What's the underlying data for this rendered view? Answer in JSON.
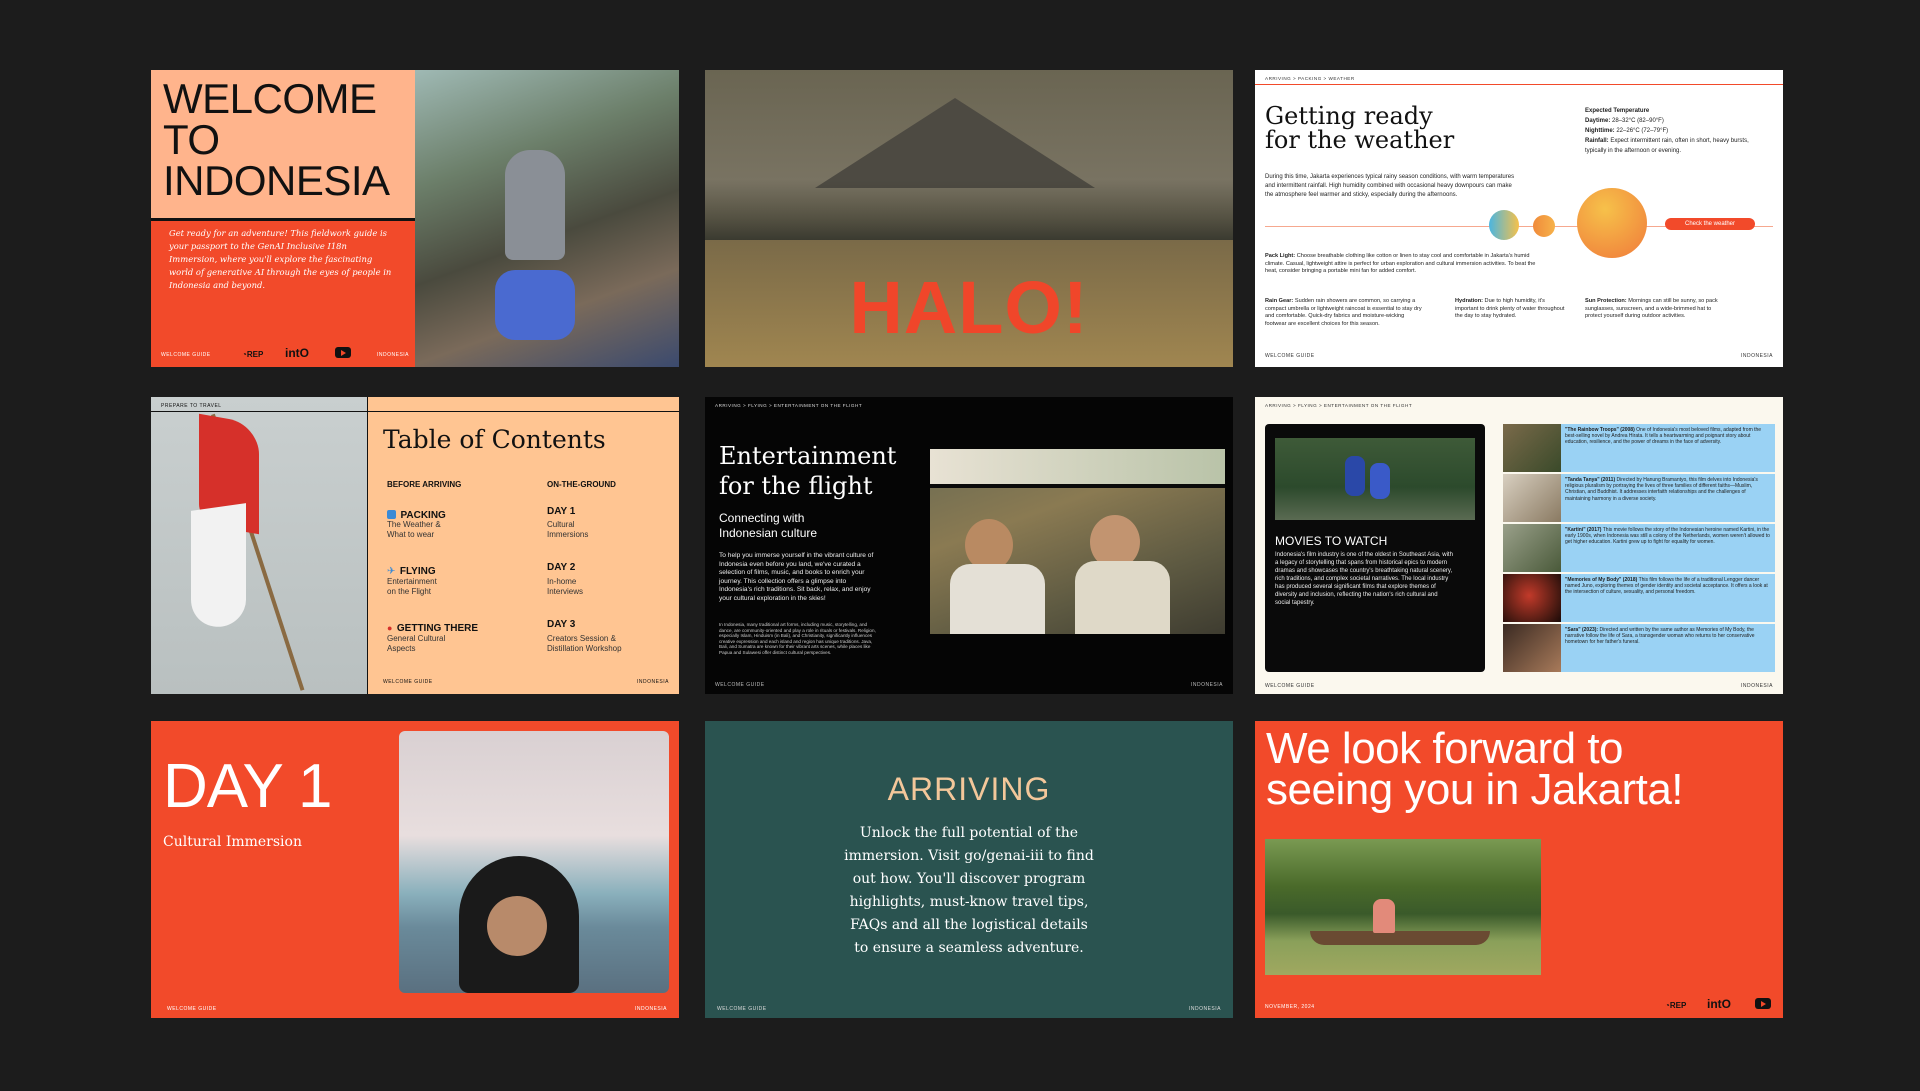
{
  "slide1": {
    "title_lines": [
      "WELCOME",
      "TO",
      "INDONESIA"
    ],
    "intro": "Get ready for an adventure! This fieldwork guide is your passport to the GenAI Inclusive I18n Immersion, where you'll explore the fascinating world of generative AI through the eyes of people in Indonesia and beyond.",
    "footer_left": "WELCOME GUIDE",
    "footer_right": "INDONESIA",
    "logo_rep": "REP",
    "logo_into": "intO"
  },
  "slide2": {
    "headline": "HALO!"
  },
  "slide3": {
    "breadcrumb": "ARRIVING > PACKING > WEATHER",
    "title_line1": "Getting ready",
    "title_line2": "for the weather",
    "temp_heading": "Expected Temperature",
    "daytime_label": "Daytime:",
    "daytime_value": "28–32°C (82–90°F)",
    "nighttime_label": "Nighttime:",
    "nighttime_value": "22–26°C (72–79°F)",
    "rainfall_label": "Rainfall:",
    "rainfall_value": "Expect intermittent rain, often in short, heavy bursts, typically in the afternoon or evening.",
    "intro": "During this time, Jakarta experiences typical rainy season conditions, with warm temperatures and intermittent rainfall. High humidity combined with occasional heavy downpours can make the atmosphere feel warmer and sticky, especially during the afternoons.",
    "check_button": "Check the weather",
    "pack_label": "Pack Light:",
    "pack_text": "Choose breathable clothing like cotton or linen to stay cool and comfortable in Jakarta's humid climate. Casual, lightweight attire is perfect for urban exploration and cultural immersion activities. To beat the heat, consider bringing a portable mini fan for added comfort.",
    "rain_label": "Rain Gear:",
    "rain_text": "Sudden rain showers are common, so carrying a compact umbrella or lightweight raincoat is essential to stay dry and comfortable. Quick-dry fabrics and moisture-wicking footwear are excellent choices for this season.",
    "hydration_label": "Hydration:",
    "hydration_text": "Due to high humidity, it's important to drink plenty of water throughout the day to stay hydrated.",
    "sun_label": "Sun Protection:",
    "sun_text": "Mornings can still be sunny, so pack sunglasses, sunscreen, and a wide-brimmed hat to protect yourself during outdoor activities.",
    "footer_left": "WELCOME GUIDE",
    "footer_right": "INDONESIA"
  },
  "slide4": {
    "label": "PREPARE TO TRAVEL",
    "title": "Table of Contents",
    "col1_heading": "BEFORE ARRIVING",
    "col2_heading": "ON-THE-GROUND",
    "packing": "PACKING",
    "packing_sub1": "The Weather &",
    "packing_sub2": "What to wear",
    "flying": "FLYING",
    "flying_sub1": "Entertainment",
    "flying_sub2": "on the Flight",
    "getting": "GETTING THERE",
    "getting_sub1": "General Cultural",
    "getting_sub2": "Aspects",
    "day1": "DAY 1",
    "day1_sub1": "Cultural",
    "day1_sub2": "Immersions",
    "day2": "DAY 2",
    "day2_sub1": "In-home",
    "day2_sub2": "Interviews",
    "day3": "DAY 3",
    "day3_sub1": "Creators Session &",
    "day3_sub2": "Distillation Workshop",
    "footer_left": "WELCOME GUIDE",
    "footer_right": "INDONESIA"
  },
  "slide5": {
    "breadcrumb": "ARRIVING > FLYING > ENTERTAINMENT ON THE FLIGHT",
    "title_line1": "Entertainment",
    "title_line2": "for the flight",
    "subtitle_line1": "Connecting with",
    "subtitle_line2": "Indonesian culture",
    "body": "To help you immerse yourself in the vibrant culture of Indonesia even before you land, we've curated a selection of films, music, and books to enrich your journey. This collection offers a glimpse into Indonesia's rich traditions. Sit back, relax, and enjoy your cultural exploration in the skies!",
    "small": "In Indonesia, many traditional art forms, including music, storytelling, and dance, are community-oriented and play a role in rituals or festivals. Religion, especially Islam, Hinduism (in Bali), and Christianity, significantly influences creative expression and each island and region has unique traditions. Java, Bali, and Sumatra are known for their vibrant arts scenes, while places like Papua and Sulawesi offer distinct cultural perspectives.",
    "footer_left": "WELCOME GUIDE",
    "footer_right": "INDONESIA"
  },
  "slide6": {
    "breadcrumb": "ARRIVING > FLYING > ENTERTAINMENT ON THE FLIGHT",
    "movies_title": "MOVIES TO WATCH",
    "movies_body": "Indonesia's film industry is one of the oldest in Southeast Asia, with a legacy of storytelling that spans from historical epics to modern dramas and showcases the country's breathtaking natural scenery, rich traditions, and complex societal narratives. The local industry has produced several significant films that explore themes of diversity and inclusion, reflecting the nation's rich cultural and social tapestry.",
    "films": [
      {
        "title": "\"The Rainbow Troops\" (2008)",
        "text": "One of Indonesia's most beloved films, adapted from the best-selling novel by Andrea Hirata. It tells a heartwarming and poignant story about education, resilience, and the power of dreams in the face of adversity."
      },
      {
        "title": "\"Tanda Tanya\" (2011)",
        "text": "Directed by Hanung Bramantyo, this film delves into Indonesia's religious pluralism by portraying the lives of three families of different faiths—Muslim, Christian, and Buddhist. It addresses interfaith relationships and the challenges of maintaining harmony in a diverse society."
      },
      {
        "title": "\"Kartini\" (2017)",
        "text": "This movie follows the story of the Indonesian heroine named Kartini, in the early 1900s, when Indonesia was still a colony of the Netherlands, women weren't allowed to get higher education. Kartini grew up to fight for equality for women."
      },
      {
        "title": "\"Memories of My Body\" (2018)",
        "text": "This film follows the life of a traditional Lengger dancer named Juno, exploring themes of gender identity and societal acceptance. It offers a look at the intersection of culture, sexuality, and personal freedom."
      },
      {
        "title": "\"Sara\" (2023):",
        "text": "Directed and written by the same author as Memories of My Body, the narrative follow the life of Sara, a transgender woman who returns to her conservative hometown for her father's funeral."
      }
    ],
    "footer_left": "WELCOME GUIDE",
    "footer_right": "INDONESIA"
  },
  "slide7": {
    "title": "DAY 1",
    "subtitle": "Cultural Immersion",
    "footer_left": "WELCOME GUIDE",
    "footer_right": "INDONESIA"
  },
  "slide8": {
    "title": "ARRIVING",
    "body_lines": [
      "Unlock the full potential of the",
      "immersion. Visit go/genai-iii to find",
      "out how.  You'll discover program",
      "highlights, must-know travel tips,",
      "FAQs and all the logistical details",
      "to ensure a seamless adventure."
    ],
    "footer_left": "WELCOME GUIDE",
    "footer_right": "INDONESIA"
  },
  "slide9": {
    "title_line1": "We look forward to",
    "title_line2": "seeing you in Jakarta!",
    "footer_left": "NOVEMBER, 2024",
    "logo_rep": "REP",
    "logo_into": "intO"
  }
}
